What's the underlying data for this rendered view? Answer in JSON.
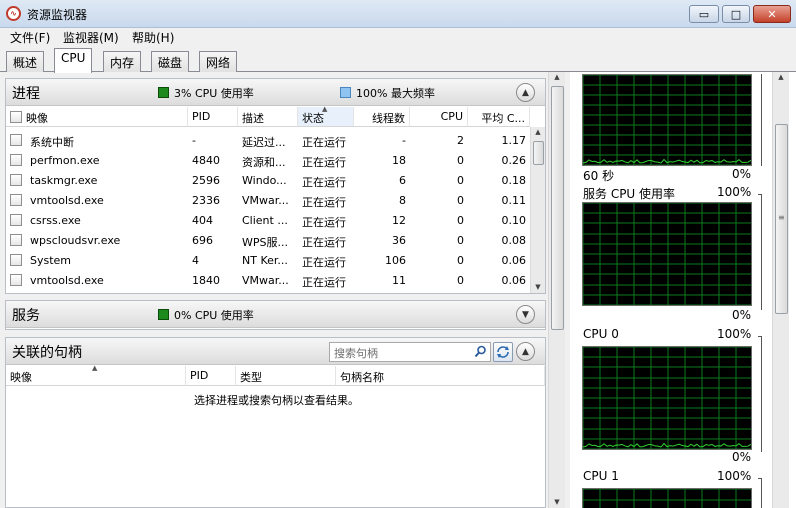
{
  "window": {
    "title": "资源监视器",
    "buttons": {
      "minimize": "▭",
      "maximize": "□",
      "close": "✕"
    }
  },
  "menu": [
    "文件(F)",
    "监视器(M)",
    "帮助(H)"
  ],
  "tabs": [
    "概述",
    "CPU",
    "内存",
    "磁盘",
    "网络"
  ],
  "active_tab": 1,
  "processes": {
    "title": "进程",
    "cpu_legend": "3% CPU 使用率",
    "freq_legend": "100% 最大频率",
    "columns": [
      "映像",
      "PID",
      "描述",
      "状态",
      "线程数",
      "CPU",
      "平均 C..."
    ],
    "rows": [
      [
        "系统中断",
        "-",
        "延迟过...",
        "正在运行",
        "-",
        "2",
        "1.17"
      ],
      [
        "perfmon.exe",
        "4840",
        "资源和...",
        "正在运行",
        "18",
        "0",
        "0.26"
      ],
      [
        "taskmgr.exe",
        "2596",
        "Windo...",
        "正在运行",
        "6",
        "0",
        "0.18"
      ],
      [
        "vmtoolsd.exe",
        "2336",
        "VMwar...",
        "正在运行",
        "8",
        "0",
        "0.11"
      ],
      [
        "csrss.exe",
        "404",
        "Client ...",
        "正在运行",
        "12",
        "0",
        "0.10"
      ],
      [
        "wpscloudsvr.exe",
        "696",
        "WPS服...",
        "正在运行",
        "36",
        "0",
        "0.08"
      ],
      [
        "System",
        "4",
        "NT Ker...",
        "正在运行",
        "106",
        "0",
        "0.06"
      ],
      [
        "vmtoolsd.exe",
        "1840",
        "VMwar...",
        "正在运行",
        "11",
        "0",
        "0.06"
      ]
    ]
  },
  "services": {
    "title": "服务",
    "cpu_legend": "0% CPU 使用率"
  },
  "handles": {
    "title": "关联的句柄",
    "search_placeholder": "搜索句柄",
    "columns": [
      "映像",
      "PID",
      "类型",
      "句柄名称"
    ],
    "empty_message": "选择进程或搜索句柄以查看结果。"
  },
  "graphs": [
    {
      "label_left": "60 秒",
      "label_right": "0%"
    },
    {
      "label_left": "服务 CPU 使用率",
      "label_right": "100%",
      "bottom_right": "0%"
    },
    {
      "label_left": "CPU 0",
      "label_right": "100%",
      "bottom_right": "0%"
    },
    {
      "label_left": "CPU 1",
      "label_right": "100%"
    }
  ],
  "colors": {
    "graph_bg": "#000000",
    "graph_grid": "#0a7a1e",
    "graph_line": "#30d030",
    "cpu_legend": "#1c8a1c",
    "freq_legend": "#8fc3f0"
  }
}
